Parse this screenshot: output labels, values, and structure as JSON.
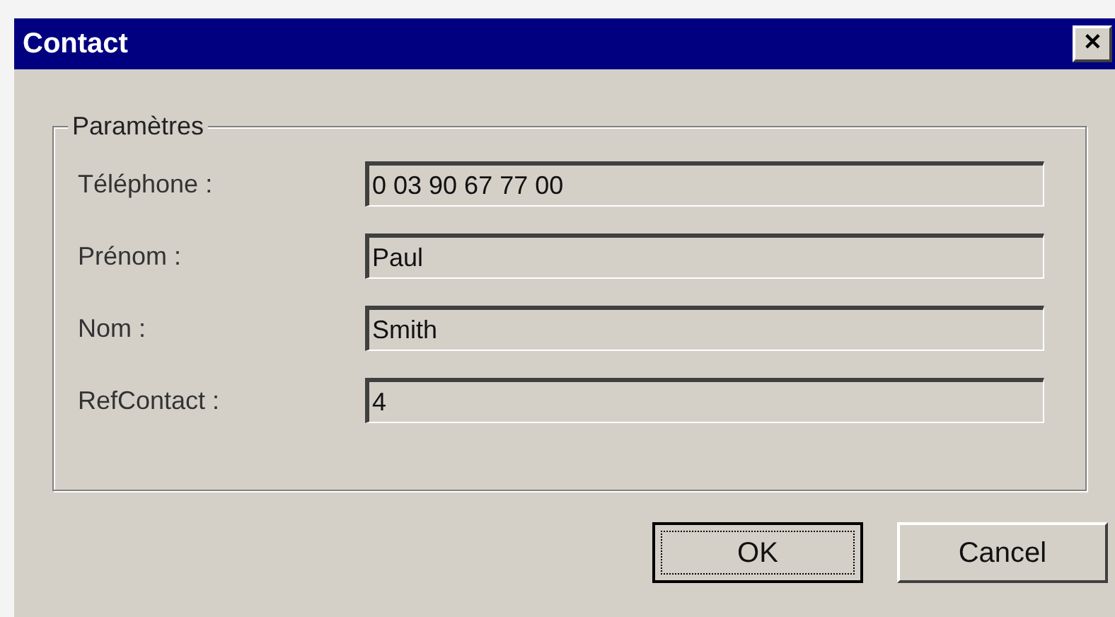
{
  "window": {
    "title": "Contact",
    "close": "✕"
  },
  "group": {
    "title": "Paramètres"
  },
  "fields": [
    {
      "label": "Téléphone :",
      "value": "0 03 90 67 77 00"
    },
    {
      "label": "Prénom :",
      "value": "Paul"
    },
    {
      "label": "Nom :",
      "value": "Smith"
    },
    {
      "label": "RefContact :",
      "value": "4"
    }
  ],
  "buttons": [
    {
      "label": "OK",
      "default": true
    },
    {
      "label": "Cancel",
      "default": false
    }
  ]
}
